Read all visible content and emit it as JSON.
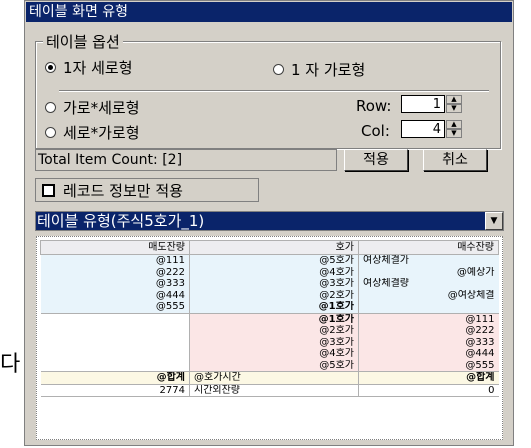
{
  "side_char": "다",
  "window": {
    "title": "테이블 화면 유형"
  },
  "options": {
    "legend": "테이블 옵션",
    "radio_1col": "1자 세로형",
    "radio_1row": "1 자 가로형",
    "radio_hv": "가로*세로형",
    "radio_vh": "세로*가로형",
    "row_label": "Row:",
    "row_value": "1",
    "col_label": "Col:",
    "col_value": "4"
  },
  "count_text": "Total Item Count: [2]",
  "apply_label": "적용",
  "cancel_label": "취소",
  "record_only_label": "레코드 정보만 적용",
  "table_type_value": "테이블 유형(주식5호가_1)",
  "preview": {
    "headers": [
      "매도잔량",
      "호가",
      "매수잔량"
    ],
    "ask_rows": [
      [
        "@111",
        "@5호가",
        "여상체결가"
      ],
      [
        "@222",
        "@4호가",
        "@예상가"
      ],
      [
        "@333",
        "@3호가",
        "여상체결량"
      ],
      [
        "@444",
        "@2호가",
        "@여상체결"
      ],
      [
        "@555",
        "@1호가",
        ""
      ]
    ],
    "bid_rows": [
      [
        "",
        "@1호가",
        "@111"
      ],
      [
        "",
        "@2호가",
        "@222"
      ],
      [
        "",
        "@3호가",
        "@333"
      ],
      [
        "",
        "@4호가",
        "@444"
      ],
      [
        "",
        "@5호가",
        "@555"
      ]
    ],
    "total_row": [
      "@합계",
      "@호가시간",
      "@합계"
    ],
    "extra_row": [
      "2774",
      "시간외잔량",
      "0"
    ]
  }
}
